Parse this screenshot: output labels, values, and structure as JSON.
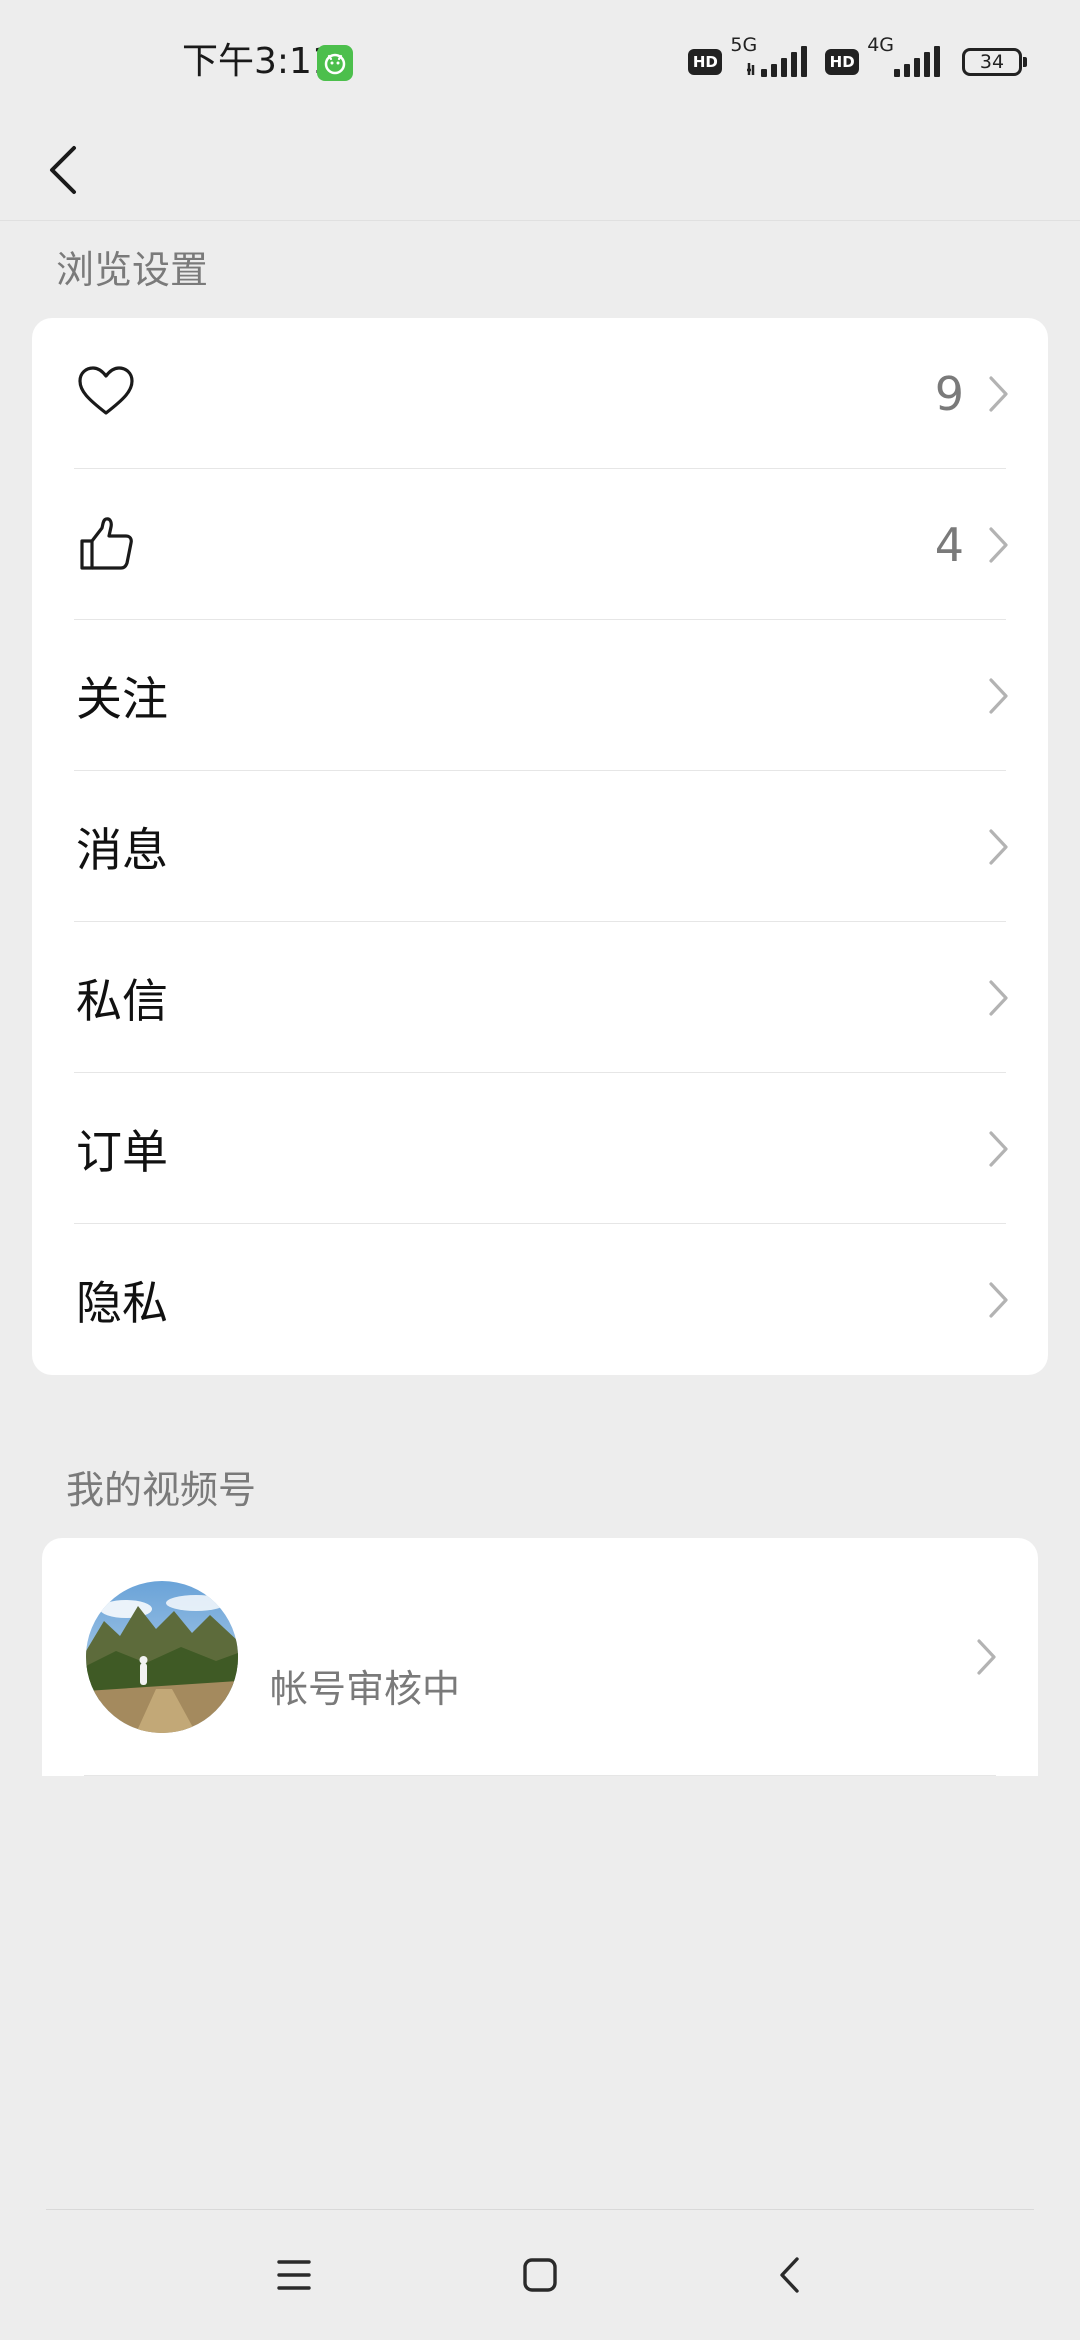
{
  "status_bar": {
    "time": "下午3:11",
    "hd_badge_1": "HD",
    "network_1": "5G",
    "hd_badge_2": "HD",
    "network_2": "4G",
    "battery": "34",
    "notification_color": "#4cbf4c"
  },
  "header": {
    "back_icon": "chevron-left-icon"
  },
  "browse_settings": {
    "title": "浏览设置",
    "rows": [
      {
        "icon": "heart-icon",
        "label": "",
        "count": "9"
      },
      {
        "icon": "thumbs-up-icon",
        "label": "",
        "count": "4"
      },
      {
        "label": "关注",
        "count": ""
      },
      {
        "label": "消息",
        "count": ""
      },
      {
        "label": "私信",
        "count": ""
      },
      {
        "label": "订单",
        "count": ""
      },
      {
        "label": "隐私",
        "count": ""
      }
    ]
  },
  "my_channels": {
    "title": "我的视频号",
    "status": "帐号审核中"
  },
  "nav_bar": {
    "menu_icon": "menu-icon",
    "home_icon": "square-home-icon",
    "back_icon": "triangle-back-icon"
  },
  "colors": {
    "background": "#ededed",
    "card": "#ffffff",
    "secondary_text": "#7a7a7a",
    "chevron": "#b3b3b3"
  }
}
